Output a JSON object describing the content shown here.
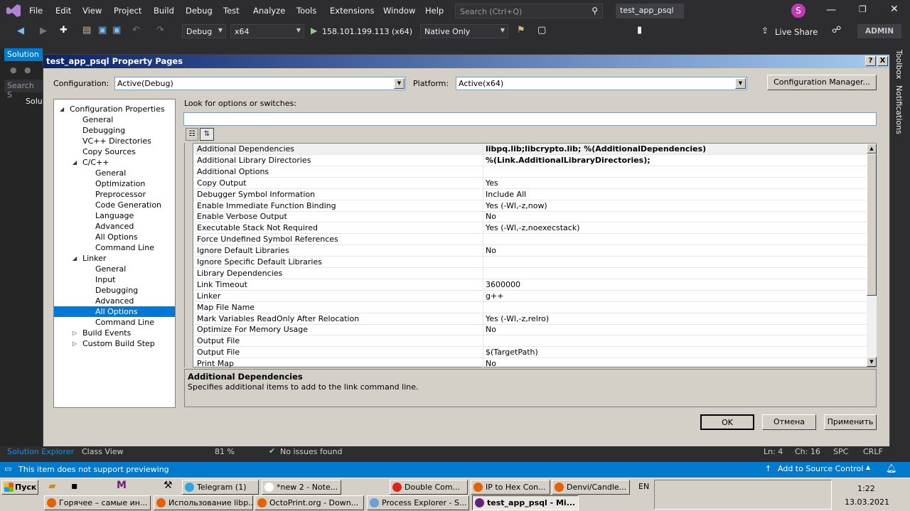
{
  "menubar": {
    "items": [
      "File",
      "Edit",
      "View",
      "Project",
      "Build",
      "Debug",
      "Test",
      "Analyze",
      "Tools",
      "Extensions",
      "Window",
      "Help"
    ],
    "search_placeholder": "Search (Ctrl+Q)",
    "project_name": "test_app_psql",
    "avatar_letter": "S"
  },
  "toolbar": {
    "config": "Debug",
    "platform": "x64",
    "target": "158.101.199.113 (x64)",
    "debugger": "Native Only",
    "live_share": "Live Share",
    "admin": "ADMIN"
  },
  "sidebar": {
    "solution_tab": "Solution",
    "search": "Search S",
    "solu": "Solu"
  },
  "right_strip": {
    "toolbox": "Toolbox",
    "notifications": "Notifications"
  },
  "dialog": {
    "title": "test_app_psql Property Pages",
    "help_btn": "?",
    "close_btn": "X",
    "configuration_label": "Configuration:",
    "configuration_value": "Active(Debug)",
    "platform_label": "Platform:",
    "platform_value": "Active(x64)",
    "config_manager": "Configuration Manager...",
    "look_for": "Look for options or switches:",
    "tree": [
      {
        "label": "Configuration Properties",
        "level": 0,
        "exp": "◢"
      },
      {
        "label": "General",
        "level": 1
      },
      {
        "label": "Debugging",
        "level": 1
      },
      {
        "label": "VC++ Directories",
        "level": 1
      },
      {
        "label": "Copy Sources",
        "level": 1
      },
      {
        "label": "C/C++",
        "level": 1,
        "exp": "◢"
      },
      {
        "label": "General",
        "level": 2
      },
      {
        "label": "Optimization",
        "level": 2
      },
      {
        "label": "Preprocessor",
        "level": 2
      },
      {
        "label": "Code Generation",
        "level": 2
      },
      {
        "label": "Language",
        "level": 2
      },
      {
        "label": "Advanced",
        "level": 2
      },
      {
        "label": "All Options",
        "level": 2
      },
      {
        "label": "Command Line",
        "level": 2
      },
      {
        "label": "Linker",
        "level": 1,
        "exp": "◢"
      },
      {
        "label": "General",
        "level": 2
      },
      {
        "label": "Input",
        "level": 2
      },
      {
        "label": "Debugging",
        "level": 2
      },
      {
        "label": "Advanced",
        "level": 2
      },
      {
        "label": "All Options",
        "level": 2,
        "selected": true
      },
      {
        "label": "Command Line",
        "level": 2
      },
      {
        "label": "Build Events",
        "level": 1,
        "exp": "▷"
      },
      {
        "label": "Custom Build Step",
        "level": 1,
        "exp": "▷"
      }
    ],
    "props": [
      {
        "name": "Additional Dependencies",
        "value": "libpq.lib;libcrypto.lib; %(AdditionalDependencies)",
        "bold": true
      },
      {
        "name": "Additional Library Directories",
        "value": "%(Link.AdditionalLibraryDirectories);",
        "bold": true
      },
      {
        "name": "Additional Options",
        "value": ""
      },
      {
        "name": "Copy Output",
        "value": "Yes"
      },
      {
        "name": "Debugger Symbol Information",
        "value": "Include All"
      },
      {
        "name": "Enable Immediate Function Binding",
        "value": "Yes (-Wl,-z,now)"
      },
      {
        "name": "Enable Verbose Output",
        "value": "No"
      },
      {
        "name": "Executable Stack Not Required",
        "value": "Yes (-Wl,-z,noexecstack)"
      },
      {
        "name": "Force Undefined Symbol References",
        "value": ""
      },
      {
        "name": "Ignore Default Libraries",
        "value": "No"
      },
      {
        "name": "Ignore Specific Default Libraries",
        "value": ""
      },
      {
        "name": "Library Dependencies",
        "value": ""
      },
      {
        "name": "Link Timeout",
        "value": "3600000"
      },
      {
        "name": "Linker",
        "value": "g++"
      },
      {
        "name": "Map File Name",
        "value": ""
      },
      {
        "name": "Mark Variables ReadOnly After Relocation",
        "value": "Yes (-Wl,-z,relro)"
      },
      {
        "name": "Optimize For Memory Usage",
        "value": "No"
      },
      {
        "name": "Output File",
        "value": ""
      },
      {
        "name": "Output File",
        "value": "$(TargetPath)"
      },
      {
        "name": "Print Map",
        "value": "No"
      }
    ],
    "desc_title": "Additional Dependencies",
    "desc_text": "Specifies additional items to add to the link command line.",
    "ok": "OK",
    "cancel": "Отмена",
    "apply": "Применить"
  },
  "subbar": {
    "solution_explorer": "Solution Explorer",
    "class_view": "Class View",
    "zoom": "81 %",
    "issues": "No issues found",
    "ln": "Ln: 4",
    "ch": "Ch: 16",
    "spc": "SPC",
    "crlf": "CRLF"
  },
  "status": {
    "message": "This item does not support previewing",
    "source_control": "Add to Source Control"
  },
  "taskbar": {
    "start": "Пуск",
    "row1": [
      "Telegram (1)",
      "*new 2 - Note...",
      "Double Com...",
      "IP to Hex Con...",
      "Denvi/Candle..."
    ],
    "row2": [
      "Горячее – самые ин...",
      "Использование libp...",
      "OctoPrint.org - Down...",
      "Process Explorer - S...",
      "test_app_psql - Mi..."
    ],
    "lang": "EN",
    "time": "1:22",
    "date": "13.03.2021"
  }
}
